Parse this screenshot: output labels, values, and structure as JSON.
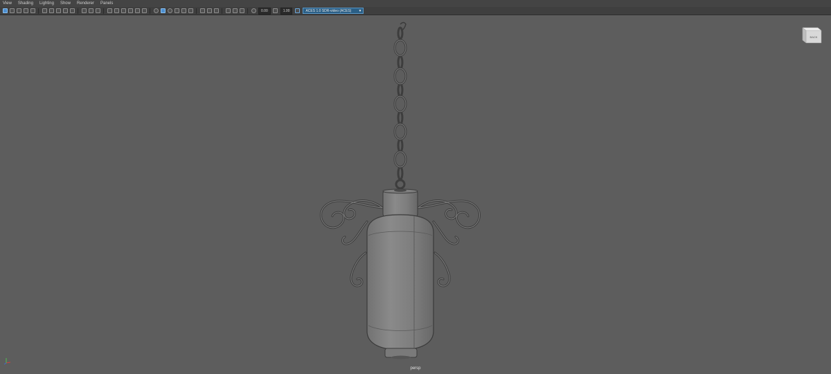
{
  "menu": [
    "View",
    "Shading",
    "Lighting",
    "Show",
    "Renderer",
    "Panels"
  ],
  "toolbar": {
    "value1": "0.00",
    "value2": "1.00",
    "colorspace": "ACES 1.0 SDR-video (ACES)"
  },
  "viewcube": {
    "face": "BACK"
  },
  "viewport": {
    "camera": "persp"
  }
}
